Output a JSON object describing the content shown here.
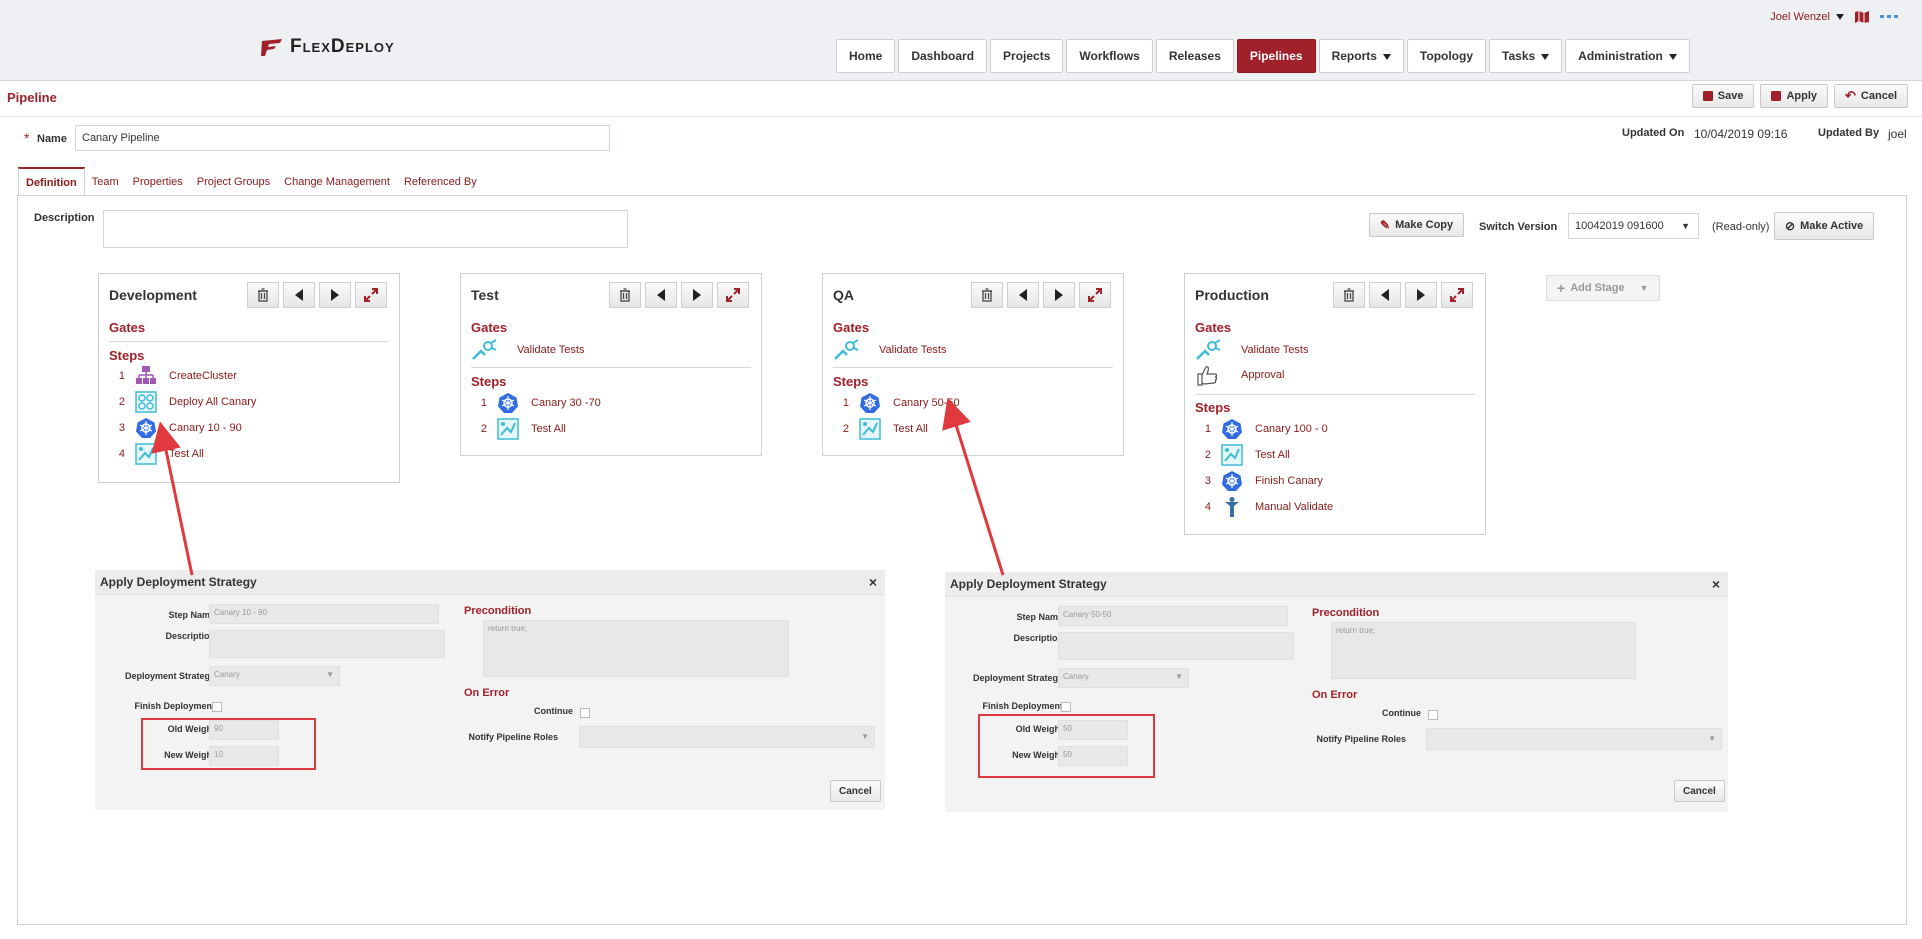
{
  "app": {
    "logo_text": "FlexDeploy"
  },
  "user": {
    "name": "Joel Wenzel"
  },
  "nav": {
    "tabs": [
      {
        "label": "Home"
      },
      {
        "label": "Dashboard"
      },
      {
        "label": "Projects"
      },
      {
        "label": "Workflows"
      },
      {
        "label": "Releases"
      },
      {
        "label": "Pipelines"
      },
      {
        "label": "Reports"
      },
      {
        "label": "Topology"
      },
      {
        "label": "Tasks"
      },
      {
        "label": "Administration"
      }
    ]
  },
  "page": {
    "title": "Pipeline",
    "save_label": "Save",
    "apply_label": "Apply",
    "cancel_label": "Cancel",
    "name_label": "Name",
    "name_value": "Canary Pipeline",
    "updated_on_label": "Updated On",
    "updated_on_value": "10/04/2019 09:16",
    "updated_by_label": "Updated By",
    "updated_by_value": "joel"
  },
  "tabs": [
    "Definition",
    "Team",
    "Properties",
    "Project Groups",
    "Change Management",
    "Referenced By"
  ],
  "definition": {
    "description_label": "Description",
    "make_copy_label": "Make Copy",
    "switch_version_label": "Switch Version",
    "switch_version_value": "10042019 091600",
    "readonly_label": "(Read-only)",
    "make_active_label": "Make Active",
    "add_stage_label": "Add Stage"
  },
  "stages": [
    {
      "name": "Development",
      "gates_label": "Gates",
      "steps_label": "Steps",
      "gates": [],
      "steps": [
        {
          "num": "1",
          "label": "CreateCluster",
          "icon": "cluster-icon"
        },
        {
          "num": "2",
          "label": "Deploy All Canary",
          "icon": "deploy-icon"
        },
        {
          "num": "3",
          "label": "Canary 10 - 90",
          "icon": "kubernetes-icon"
        },
        {
          "num": "4",
          "label": "Test All",
          "icon": "test-icon"
        }
      ]
    },
    {
      "name": "Test",
      "gates_label": "Gates",
      "steps_label": "Steps",
      "gates": [
        {
          "label": "Validate Tests",
          "icon": "validate-icon"
        }
      ],
      "steps": [
        {
          "num": "1",
          "label": "Canary 30 -70",
          "icon": "kubernetes-icon"
        },
        {
          "num": "2",
          "label": "Test All",
          "icon": "test-icon"
        }
      ]
    },
    {
      "name": "QA",
      "gates_label": "Gates",
      "steps_label": "Steps",
      "gates": [
        {
          "label": "Validate Tests",
          "icon": "validate-icon"
        }
      ],
      "steps": [
        {
          "num": "1",
          "label": "Canary 50-50",
          "icon": "kubernetes-icon"
        },
        {
          "num": "2",
          "label": "Test All",
          "icon": "test-icon"
        }
      ]
    },
    {
      "name": "Production",
      "gates_label": "Gates",
      "steps_label": "Steps",
      "gates": [
        {
          "label": "Validate Tests",
          "icon": "validate-icon"
        },
        {
          "label": "Approval",
          "icon": "thumbs-up-icon"
        }
      ],
      "steps": [
        {
          "num": "1",
          "label": "Canary 100 - 0",
          "icon": "kubernetes-icon"
        },
        {
          "num": "2",
          "label": "Test All",
          "icon": "test-icon"
        },
        {
          "num": "3",
          "label": "Finish Canary",
          "icon": "kubernetes-icon"
        },
        {
          "num": "4",
          "label": "Manual Validate",
          "icon": "person-icon"
        }
      ]
    }
  ],
  "dialogs": [
    {
      "title": "Apply Deployment Strategy",
      "step_name_label": "Step Name",
      "step_name_value": "Canary 10 - 90",
      "description_label": "Description",
      "strategy_label": "Deployment Strategy",
      "strategy_value": "Canary",
      "finish_label": "Finish Deployment",
      "old_weight_label": "Old Weight",
      "old_weight_value": "90",
      "new_weight_label": "New Weight",
      "new_weight_value": "10",
      "precondition_label": "Precondition",
      "precondition_value": "return true;",
      "on_error_label": "On Error",
      "continue_label": "Continue",
      "notify_label": "Notify Pipeline Roles",
      "cancel_label": "Cancel"
    },
    {
      "title": "Apply Deployment Strategy",
      "step_name_label": "Step Name",
      "step_name_value": "Canary 50-50",
      "description_label": "Description",
      "strategy_label": "Deployment Strategy",
      "strategy_value": "Canary",
      "finish_label": "Finish Deployment",
      "old_weight_label": "Old Weight",
      "old_weight_value": "50",
      "new_weight_label": "New Weight",
      "new_weight_value": "50",
      "precondition_label": "Precondition",
      "precondition_value": "return true;",
      "on_error_label": "On Error",
      "continue_label": "Continue",
      "notify_label": "Notify Pipeline Roles",
      "cancel_label": "Cancel"
    }
  ],
  "colors": {
    "brand": "#a0212a",
    "link": "#8b1a1a",
    "k8s": "#326ce5",
    "annotation": "#e0393e"
  }
}
